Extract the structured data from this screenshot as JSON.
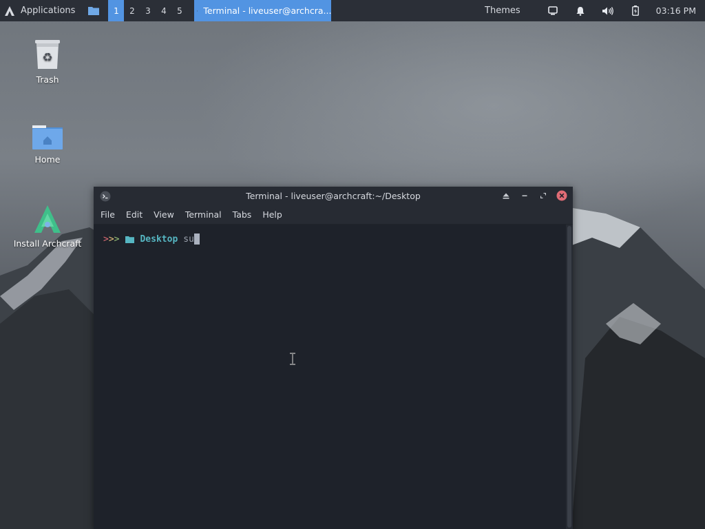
{
  "panel": {
    "app_menu_label": "Applications",
    "workspaces": [
      "1",
      "2",
      "3",
      "4",
      "5"
    ],
    "active_workspace": "1",
    "task_button_label": "Terminal - liveuser@archcra...",
    "themes_label": "Themes",
    "clock": "03:16 PM",
    "accent_color": "#5294e2"
  },
  "desktop": {
    "icons": [
      {
        "label": "Trash",
        "icon": "trash-icon"
      },
      {
        "label": "Home",
        "icon": "home-folder-icon"
      },
      {
        "label": "Install Archcraft",
        "icon": "archcraft-installer-icon"
      }
    ]
  },
  "terminal": {
    "window_title": "Terminal - liveuser@archcraft:~/Desktop",
    "menu": [
      "File",
      "Edit",
      "View",
      "Terminal",
      "Tabs",
      "Help"
    ],
    "prompt_arrows": ">>>",
    "prompt_dir": "Desktop",
    "command_input": "su"
  }
}
